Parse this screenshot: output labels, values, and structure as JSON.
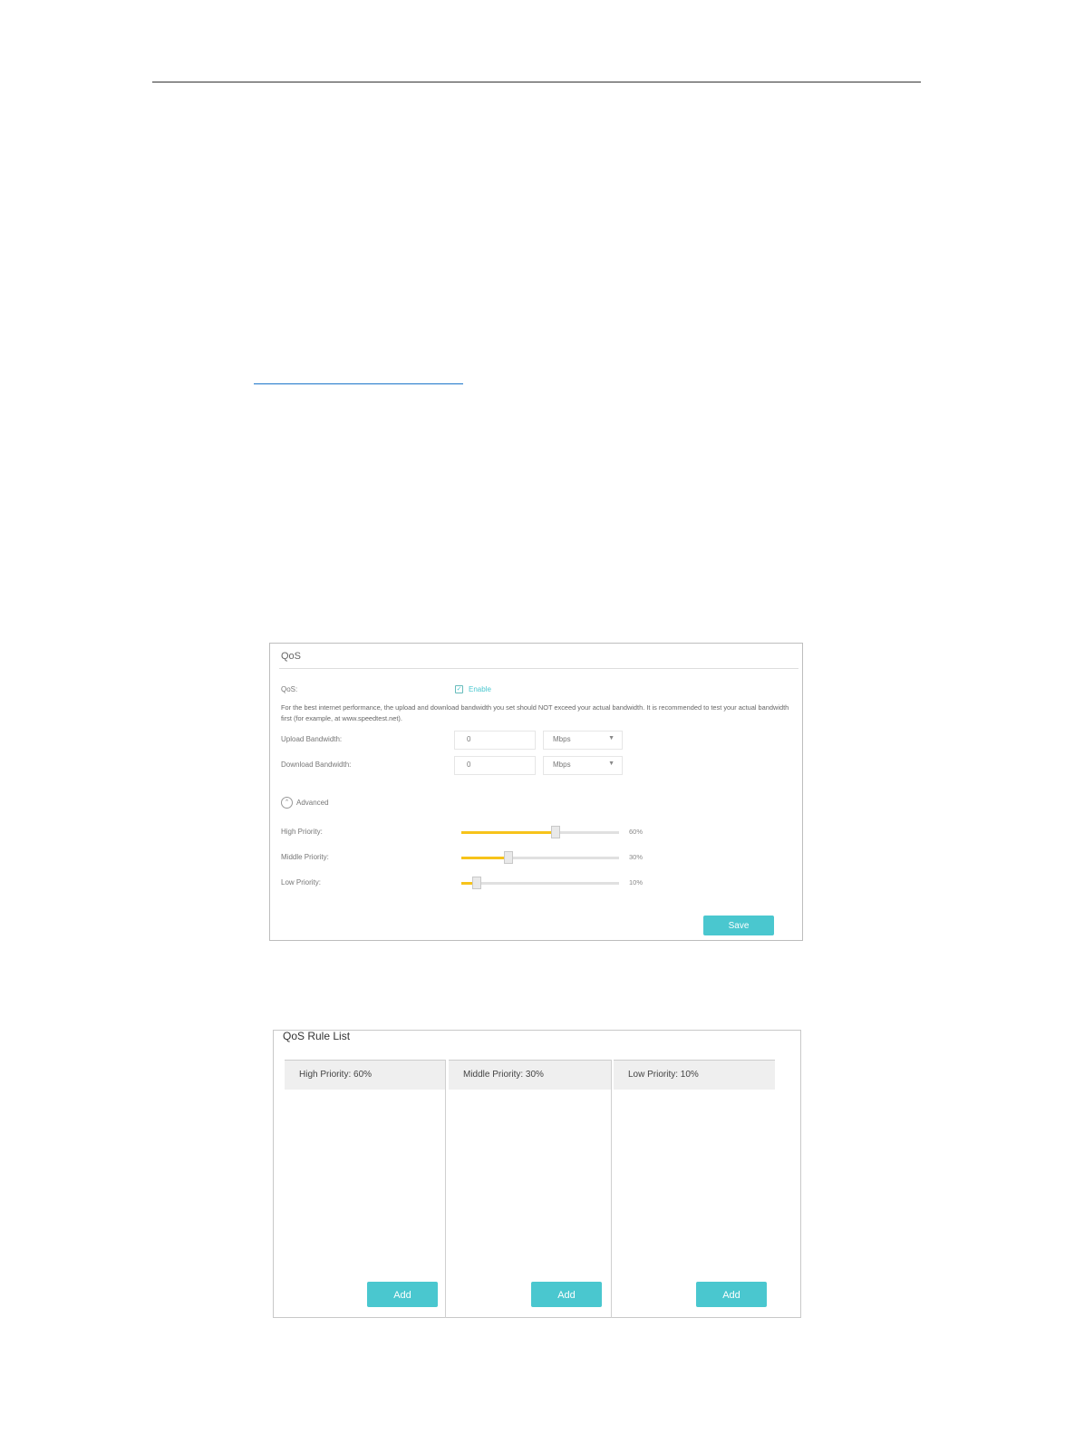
{
  "qos": {
    "title": "QoS",
    "qos_label": "QoS:",
    "enable_label": "Enable",
    "enabled": true,
    "hint": "For the best internet performance, the upload and download bandwidth you set should NOT exceed your actual bandwidth. It is recommended to test your actual bandwidth first (for example, at www.speedtest.net).",
    "upload_label": "Upload Bandwidth:",
    "upload_value": "0",
    "upload_unit": "Mbps",
    "download_label": "Download Bandwidth:",
    "download_value": "0",
    "download_unit": "Mbps",
    "advanced_label": "Advanced",
    "priorities": [
      {
        "label": "High Priority:",
        "percent_text": "60%",
        "value": 60
      },
      {
        "label": "Middle Priority:",
        "percent_text": "30%",
        "value": 30
      },
      {
        "label": "Low Priority:",
        "percent_text": "10%",
        "value": 10
      }
    ],
    "save_label": "Save"
  },
  "rule_list": {
    "title": "QoS Rule List",
    "columns": [
      {
        "header": "High Priority: 60%",
        "add_label": "Add"
      },
      {
        "header": "Middle Priority: 30%",
        "add_label": "Add"
      },
      {
        "header": "Low Priority: 10%",
        "add_label": "Add"
      }
    ]
  },
  "colors": {
    "accent": "#4ac7cf",
    "slider_fill": "#f7c31a"
  },
  "icons": {
    "checkbox": "check-icon",
    "advanced": "chevron-up-circle-icon",
    "select": "caret-down-icon"
  }
}
